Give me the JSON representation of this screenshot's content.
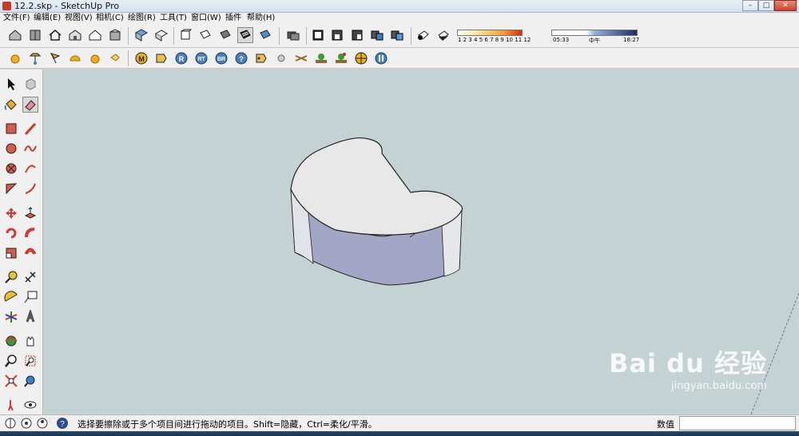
{
  "window": {
    "title": "12.2.skp - SketchUp Pro",
    "minimize": "–",
    "maximize": "□",
    "close": "✕"
  },
  "menu": [
    "文件(F)",
    "编辑(E)",
    "视图(V)",
    "相机(C)",
    "绘图(R)",
    "工具(T)",
    "窗口(W)",
    "插件",
    "帮助(H)"
  ],
  "shadow_panel": {
    "months": "1 2 3 4 5 6 7 8 9 10 11 12",
    "time_start": "05:33",
    "time_mid": "中午",
    "time_end": "18:27"
  },
  "plugin_buttons": {
    "m": "M",
    "r": "R",
    "rt": "RT",
    "br": "BR",
    "help": "?"
  },
  "status": {
    "message": "选择要擦除或于多个项目间进行拖动的项目。Shift=隐藏，Ctrl=柔化/平滑。",
    "vcb_label": "数值",
    "vcb_value": ""
  },
  "watermark": {
    "brand": "Bai du 经验",
    "url": "jingyan.baidu.com"
  },
  "colors": {
    "viewport_bg": "#c4d2d3",
    "top_face": "#e8e8e8",
    "side_face": "#a2a6c4",
    "side_face_light": "#e0e2e6"
  },
  "icons": {
    "tb1": [
      "house-icon",
      "book-icon",
      "home-icon",
      "house-outline-icon",
      "house-open-icon",
      "box-icon",
      "iso-view-icon",
      "top-view-icon",
      "front-view-icon",
      "right-view-icon",
      "back-view-icon",
      "shaded-style-icon",
      "texture-style-icon",
      "xray-icon",
      "layers-icon",
      "components-icon",
      "materials-icon",
      "styles-icon",
      "shadows-icon",
      "fog-icon"
    ],
    "tb2": [
      "sun-icon",
      "lamp-icon",
      "flag-icon",
      "dome-icon",
      "sphere-icon",
      "sunrise-icon",
      "plugin-m-icon",
      "tag-icon",
      "plugin-r-icon",
      "plugin-rt-icon",
      "plugin-br-icon",
      "help-icon",
      "label-icon",
      "sphere-grey-icon",
      "grass-icon",
      "tree-icon",
      "tree-alt-icon",
      "target-icon",
      "pause-icon"
    ],
    "left": [
      "select-icon",
      "component-icon",
      "paint-bucket-icon",
      "eraser-icon",
      "rectangle-icon",
      "line-icon",
      "circle-icon",
      "freehand-icon",
      "polygon-icon",
      "arc-icon",
      "pie-icon",
      "arc2-icon",
      "move-icon",
      "push-pull-icon",
      "rotate-icon",
      "follow-me-icon",
      "scale-icon",
      "offset-icon",
      "tape-measure-icon",
      "dimension-icon",
      "protractor-icon",
      "text-icon",
      "axes-icon",
      "3d-text-icon",
      "orbit-icon",
      "pan-icon",
      "zoom-icon",
      "zoom-window-icon",
      "zoom-extents-icon",
      "zoom-prev-icon",
      "walk-icon",
      "look-around-icon"
    ]
  }
}
